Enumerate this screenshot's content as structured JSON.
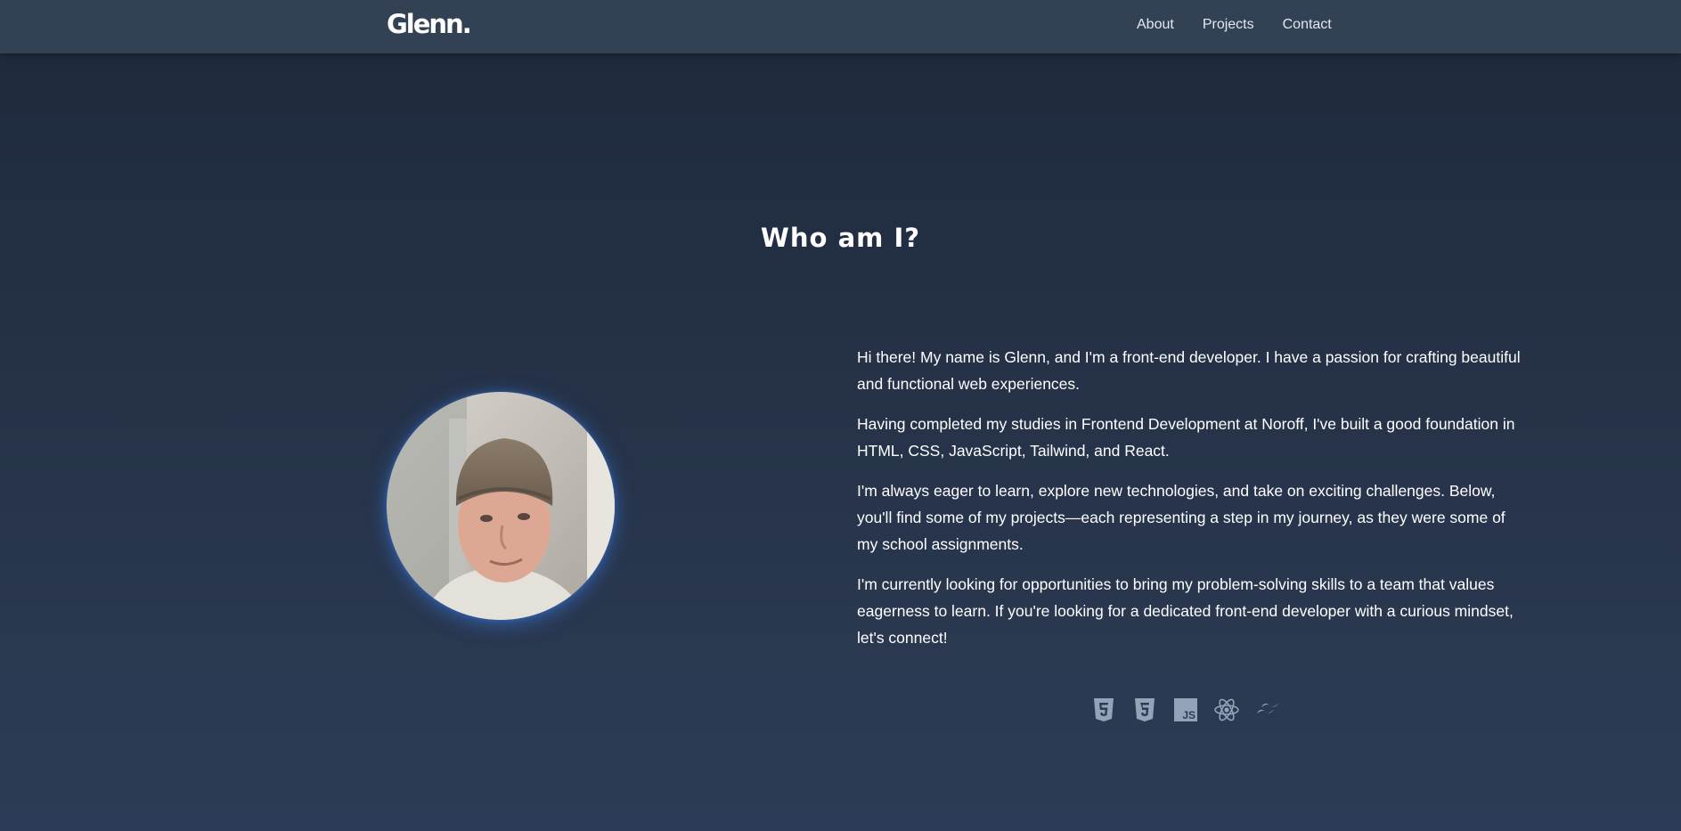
{
  "nav": {
    "logo": "Glenn.",
    "links": [
      "About",
      "Projects",
      "Contact"
    ]
  },
  "about": {
    "title": "Who am I?",
    "paragraphs": [
      "Hi there! My name is Glenn, and I'm a front-end developer. I have a passion for crafting beautiful and functional web experiences.",
      "Having completed my studies in Frontend Development at Noroff, I've built a good foundation in HTML, CSS, JavaScript, Tailwind, and React.",
      "I'm always eager to learn, explore new technologies, and take on exciting challenges. Below, you'll find some of my projects—each representing a step in my journey, as they were some of my school assignments.",
      "I'm currently looking for opportunities to bring my problem-solving skills to a team that values eagerness to learn. If you're looking for a dedicated front-end developer with a curious mindset, let's connect!"
    ]
  },
  "tech": [
    {
      "icon": "html5-icon"
    },
    {
      "icon": "css3-icon"
    },
    {
      "icon": "javascript-icon",
      "text": "JS"
    },
    {
      "icon": "react-icon"
    },
    {
      "icon": "tailwind-icon"
    }
  ],
  "colors": {
    "navbar": "#334155",
    "background_top": "#1e293b",
    "background_bottom": "#2d3c56",
    "icon": "#94a3b8",
    "avatar_glow": "#3b82f6"
  }
}
